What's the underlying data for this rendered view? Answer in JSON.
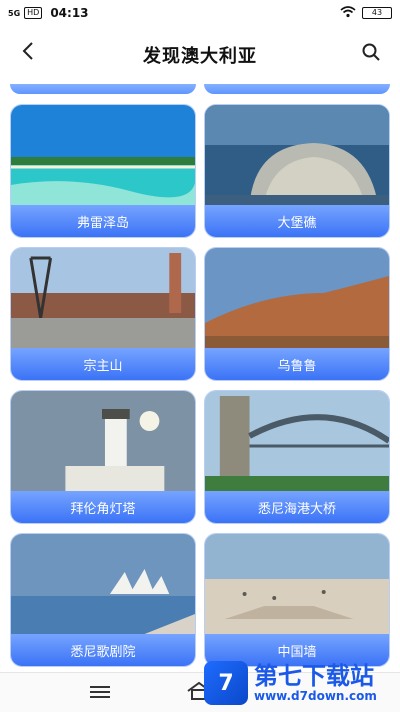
{
  "status": {
    "network": "5G",
    "hd": "HD",
    "time": "04:13",
    "battery": "43"
  },
  "header": {
    "title": "发现澳大利亚",
    "back_icon": "chevron-left-icon",
    "search_icon": "search-icon"
  },
  "cards": [
    {
      "label": "弗雷泽岛",
      "scene": "beach"
    },
    {
      "label": "大堡礁",
      "scene": "reef"
    },
    {
      "label": "宗主山",
      "scene": "mine"
    },
    {
      "label": "乌鲁鲁",
      "scene": "rock"
    },
    {
      "label": "拜伦角灯塔",
      "scene": "lighthouse"
    },
    {
      "label": "悉尼海港大桥",
      "scene": "bridge"
    },
    {
      "label": "悉尼歌剧院",
      "scene": "opera"
    },
    {
      "label": "中国墙",
      "scene": "desert"
    }
  ],
  "bottom_nav": {
    "menu_icon": "menu-icon",
    "home_icon": "home-icon"
  },
  "watermark": {
    "name": "第七下载站",
    "url": "www.d7down.com",
    "badge": "7"
  },
  "colors": {
    "label_gradient_top": "#76a4ff",
    "label_gradient_bottom": "#3b73f6",
    "watermark": "#1b59e8"
  }
}
